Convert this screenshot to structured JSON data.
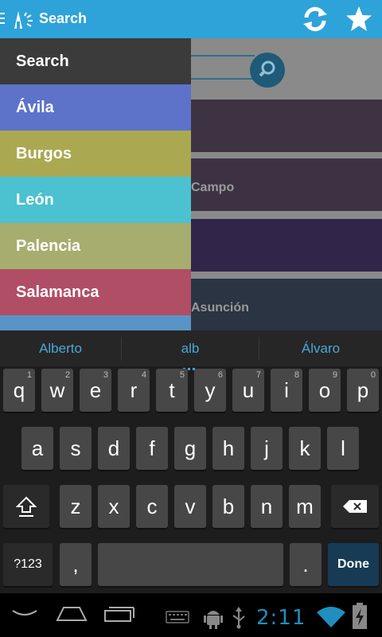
{
  "action_bar": {
    "title": "Search",
    "bg": "#2ea3d9",
    "icons": [
      "menu-icon",
      "app-logo-icon",
      "refresh-icon",
      "star-icon"
    ]
  },
  "background_list": {
    "items": [
      "",
      "Campo",
      "",
      "Asunción"
    ]
  },
  "drawer": {
    "items": [
      {
        "label": "Search",
        "color": "#3b3b3b"
      },
      {
        "label": "Ávila",
        "color": "#5c73c9"
      },
      {
        "label": "Burgos",
        "color": "#aaa952"
      },
      {
        "label": "León",
        "color": "#4cc1cf"
      },
      {
        "label": "Palencia",
        "color": "#a7ad6f"
      },
      {
        "label": "Salamanca",
        "color": "#b04e66"
      },
      {
        "label": "",
        "color": "#5a93c6"
      }
    ]
  },
  "keyboard": {
    "suggestions": [
      "Alberto",
      "alb",
      "Álvaro"
    ],
    "row1": [
      {
        "k": "q",
        "h": "1"
      },
      {
        "k": "w",
        "h": "2"
      },
      {
        "k": "e",
        "h": "3"
      },
      {
        "k": "r",
        "h": "4"
      },
      {
        "k": "t",
        "h": "5"
      },
      {
        "k": "y",
        "h": "6"
      },
      {
        "k": "u",
        "h": "7"
      },
      {
        "k": "i",
        "h": "8"
      },
      {
        "k": "o",
        "h": "9"
      },
      {
        "k": "p",
        "h": "0"
      }
    ],
    "row2": [
      "a",
      "s",
      "d",
      "f",
      "g",
      "h",
      "j",
      "k",
      "l"
    ],
    "row3": [
      "z",
      "x",
      "c",
      "v",
      "b",
      "n",
      "m"
    ],
    "symbols_label": "?123",
    "comma": ",",
    "period": ".",
    "done_label": "Done"
  },
  "status": {
    "time": "2:11",
    "accent": "#1f8fc0"
  }
}
